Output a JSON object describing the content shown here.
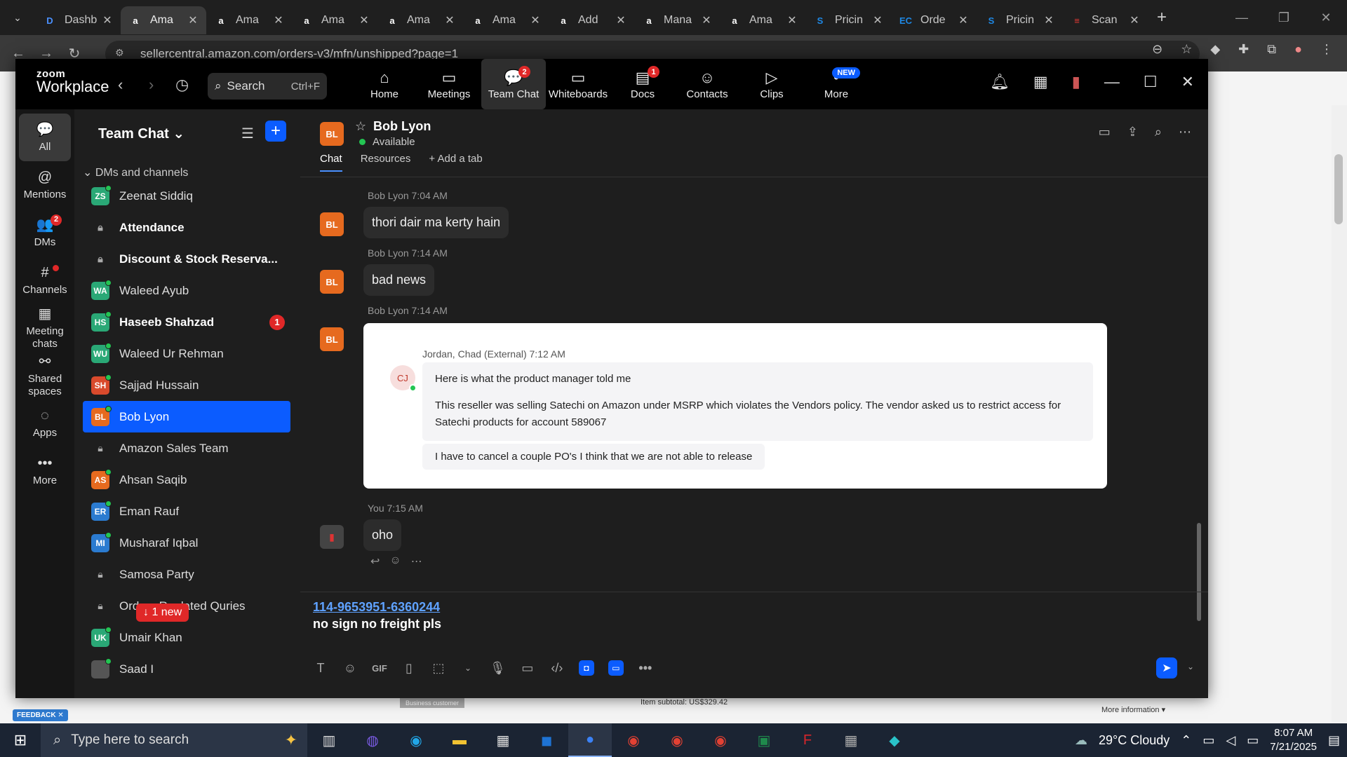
{
  "browser": {
    "tabs": [
      {
        "label": "Dashb",
        "favicon": "D",
        "color": "#4a90ff"
      },
      {
        "label": "Ama",
        "favicon": "a",
        "color": "#ffffff",
        "active": true
      },
      {
        "label": "Ama",
        "favicon": "a",
        "color": "#ffffff"
      },
      {
        "label": "Ama",
        "favicon": "a",
        "color": "#ffffff"
      },
      {
        "label": "Ama",
        "favicon": "a",
        "color": "#ffffff"
      },
      {
        "label": "Ama",
        "favicon": "a",
        "color": "#ffffff"
      },
      {
        "label": "Add",
        "favicon": "a",
        "color": "#ffffff"
      },
      {
        "label": "Mana",
        "favicon": "a",
        "color": "#ffffff"
      },
      {
        "label": "Ama",
        "favicon": "a",
        "color": "#ffffff"
      },
      {
        "label": "Pricin",
        "favicon": "S",
        "color": "#1e88e5"
      },
      {
        "label": "Orde",
        "favicon": "EC",
        "color": "#1e88e5"
      },
      {
        "label": "Pricin",
        "favicon": "S",
        "color": "#1e88e5"
      },
      {
        "label": "Scan",
        "favicon": "≡",
        "color": "#e53935"
      }
    ],
    "url": "sellercentral.amazon.com/orders-v3/mfn/unshipped?page=1"
  },
  "page": {
    "feedback": "FEEDBACK ✕",
    "business": "Business customer",
    "subtotal": "Item subtotal: US$329.42",
    "more_info": "More information ▾"
  },
  "zoom": {
    "logo_top": "zoom",
    "logo_bottom": "Workplace",
    "search_label": "Search",
    "search_shortcut": "Ctrl+F",
    "nav": [
      {
        "label": "Home",
        "icon": "home-icon",
        "glyph": "⌂"
      },
      {
        "label": "Meetings",
        "icon": "video-icon",
        "glyph": "▭"
      },
      {
        "label": "Team Chat",
        "icon": "chat-icon",
        "glyph": "💬",
        "badge": "2",
        "active": true
      },
      {
        "label": "Whiteboards",
        "icon": "whiteboard-icon",
        "glyph": "▭"
      },
      {
        "label": "Docs",
        "icon": "docs-icon",
        "glyph": "▤",
        "badge": "1"
      },
      {
        "label": "Contacts",
        "icon": "contacts-icon",
        "glyph": "☺"
      },
      {
        "label": "Clips",
        "icon": "clips-icon",
        "glyph": "▷"
      },
      {
        "label": "More",
        "icon": "more-icon",
        "glyph": "•",
        "new_badge": "NEW"
      }
    ],
    "rail": [
      {
        "label": "All",
        "icon": "all-chats-icon",
        "glyph": "💬",
        "active": true
      },
      {
        "label": "Mentions",
        "icon": "at-icon",
        "glyph": "@"
      },
      {
        "label": "DMs",
        "icon": "dms-icon",
        "glyph": "👥",
        "badge": "2"
      },
      {
        "label": "Channels",
        "icon": "hash-icon",
        "glyph": "#",
        "dot": true
      },
      {
        "label": "Meeting chats",
        "icon": "calendar-icon",
        "glyph": "▦"
      },
      {
        "label": "Shared spaces",
        "icon": "shared-spaces-icon",
        "glyph": "⚯"
      },
      {
        "label": "Apps",
        "icon": "apps-icon",
        "glyph": "◌"
      },
      {
        "label": "More",
        "icon": "more-dots-icon",
        "glyph": "•••"
      }
    ],
    "channel_list": {
      "title": "Team Chat ⌄",
      "section": "⌄  DMs and channels",
      "items": [
        {
          "name": "Zeenat Siddiq",
          "initials": "ZS",
          "color": "#2aa876",
          "type": "dm"
        },
        {
          "name": "Attendance",
          "type": "channel",
          "bold": true
        },
        {
          "name": "Discount & Stock Reserva...",
          "type": "channel",
          "bold": true
        },
        {
          "name": "Waleed Ayub",
          "initials": "WA",
          "color": "#2aa876",
          "type": "dm"
        },
        {
          "name": "Haseeb Shahzad",
          "initials": "HS",
          "color": "#2aa876",
          "type": "dm",
          "bold": true,
          "badge": "1"
        },
        {
          "name": "Waleed Ur Rehman",
          "initials": "WU",
          "color": "#2aa876",
          "type": "dm"
        },
        {
          "name": "Sajjad Hussain",
          "initials": "SH",
          "color": "#d94a2c",
          "type": "dm"
        },
        {
          "name": "Bob Lyon",
          "initials": "BL",
          "color": "#e66a1f",
          "type": "dm",
          "selected": true
        },
        {
          "name": "Amazon Sales Team",
          "type": "channel"
        },
        {
          "name": "Ahsan Saqib",
          "initials": "AS",
          "color": "#e66a1f",
          "type": "dm"
        },
        {
          "name": "Eman Rauf",
          "initials": "ER",
          "color": "#2b7bd0",
          "type": "dm"
        },
        {
          "name": "Musharaf Iqbal",
          "initials": "MI",
          "color": "#2b7bd0",
          "type": "dm"
        },
        {
          "name": "Samosa Party",
          "type": "channel"
        },
        {
          "name": "Orders Realated Quries",
          "type": "channel"
        },
        {
          "name": "Umair Khan",
          "initials": "UK",
          "color": "#2aa876",
          "type": "dm"
        },
        {
          "name": "Saad I",
          "initials": "",
          "color": "#555555",
          "type": "dm"
        }
      ],
      "new_pill": "↓ 1 new"
    },
    "chat": {
      "initials": "BL",
      "name": "Bob Lyon",
      "status": "Available",
      "tabs": [
        "Chat",
        "Resources",
        "+ Add a tab"
      ],
      "messages": [
        {
          "meta": "Bob Lyon 7:04 AM",
          "text": "thori dair ma kerty hain"
        },
        {
          "meta": "Bob Lyon 7:14 AM",
          "text": "bad news"
        },
        {
          "meta": "Bob Lyon 7:14 AM"
        },
        {
          "meta": "You 7:15 AM",
          "text": "oho"
        }
      ],
      "quote": {
        "from": "Jordan, Chad (External)   7:12 AM",
        "initials": "CJ",
        "line1": "Here is what the product manager told me",
        "line2": "This reseller was selling Satechi on Amazon under MSRP which violates the Vendors policy.  The vendor asked us to restrict access for Satechi products for account 589067",
        "line3": "I have to cancel a couple PO's I think that we are not able to release"
      },
      "composer": {
        "link": "114-9653951-6360244",
        "text": "no sign no freight pls"
      }
    }
  },
  "taskbar": {
    "search_placeholder": "Type here to search",
    "weather": "29°C  Cloudy",
    "time": "8:07 AM",
    "date": "7/21/2025"
  }
}
